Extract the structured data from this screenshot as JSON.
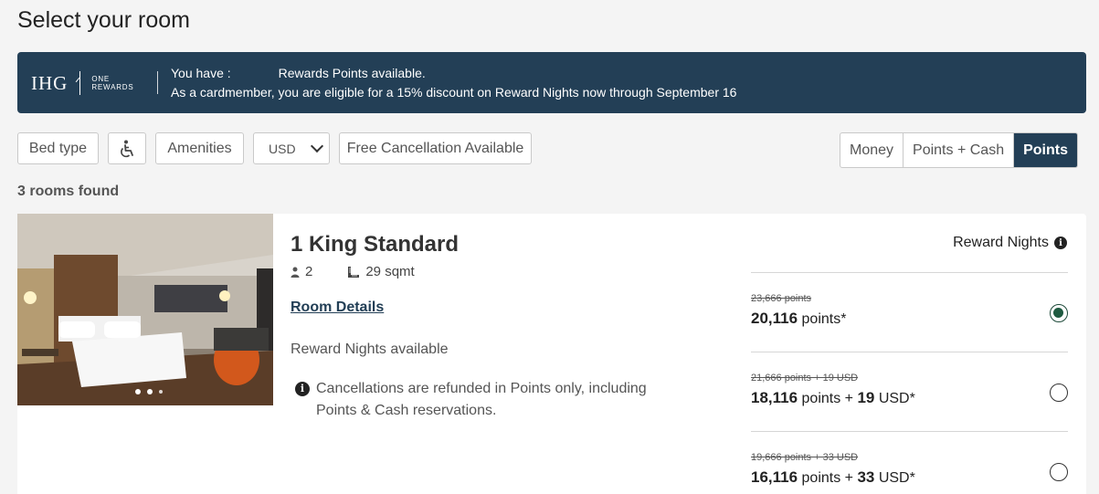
{
  "page": {
    "title": "Select your room"
  },
  "banner": {
    "logo_text": "IHG",
    "logo_sub_1": "ONE",
    "logo_sub_2": "REWARDS",
    "line1_prefix": "You have :",
    "line1_suffix": "Rewards Points available.",
    "line2": "As a cardmember, you are eligible for a 15% discount on Reward Nights now through September 16"
  },
  "filters": {
    "bed_type": "Bed type",
    "accessibility_icon": "wheelchair-icon",
    "amenities": "Amenities",
    "currency": "USD",
    "free_cancellation": "Free Cancellation Available"
  },
  "payment_toggle": {
    "options": [
      "Money",
      "Points + Cash",
      "Points"
    ],
    "selected": "Points"
  },
  "results": {
    "count_text": "3 rooms found"
  },
  "room": {
    "name": "1 King Standard",
    "guests": "2",
    "size": "29 sqmt",
    "details_link": "Room Details",
    "reward_nights": "Reward Nights available",
    "cancellation_note": "Cancellations are refunded in Points only, including Points & Cash reservations.",
    "rate_header": "Reward Nights",
    "rates": [
      {
        "original": "23,666 points",
        "points": "20,116",
        "points_label": "points*",
        "cash": "",
        "cash_label": "",
        "selected": true
      },
      {
        "original": "21,666 points + 19 USD",
        "points": "18,116",
        "points_label": "points +",
        "cash": "19",
        "cash_label": "USD*",
        "selected": false
      },
      {
        "original": "19,666 points + 33 USD",
        "points": "16,116",
        "points_label": "points +",
        "cash": "33",
        "cash_label": "USD*",
        "selected": false
      }
    ]
  },
  "colors": {
    "brand_navy": "#233f56",
    "selected_radio": "#1e5a40"
  }
}
